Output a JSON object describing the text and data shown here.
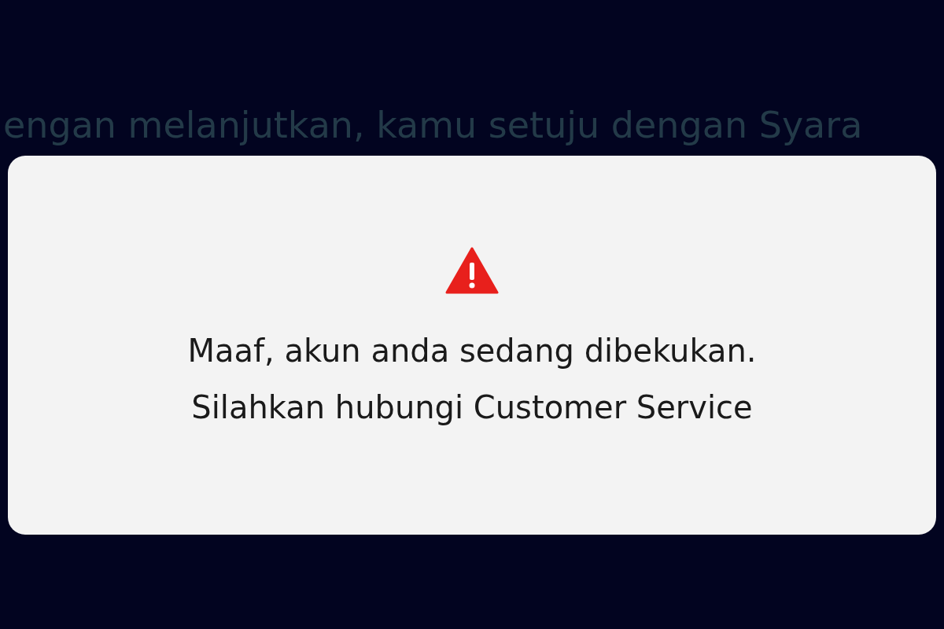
{
  "background_text": "engan melanjutkan, kamu setuju dengan Syara",
  "dialog": {
    "message_lines": [
      "Maaf, akun anda sedang dibekukan.",
      "Silahkan hubungi Customer Service"
    ]
  }
}
